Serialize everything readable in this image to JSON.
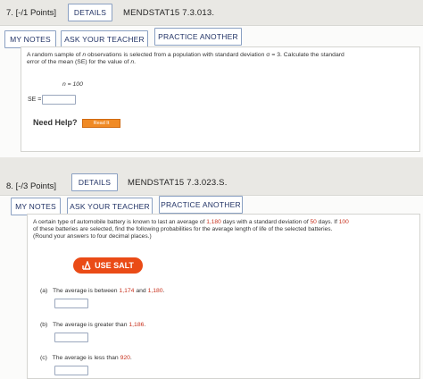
{
  "q7": {
    "number": "7.",
    "points": "[-/1 Points]",
    "details": "DETAILS",
    "code": "MENDSTAT15 7.3.013.",
    "my_notes": "MY NOTES",
    "ask_teacher": "ASK YOUR TEACHER",
    "practice": "PRACTICE ANOTHER",
    "text_line1_a": "A random sample of ",
    "text_line1_n": "n",
    "text_line1_b": " observations is selected from a population with standard deviation σ = 3. Calculate the standard",
    "text_line2_a": "error of the mean (SE) for the value of ",
    "text_line2_n": "n",
    "text_line2_b": ".",
    "n_label": "n = 100",
    "se_label": "SE =",
    "need_help": "Need Help?",
    "read_it": "Read It"
  },
  "q8": {
    "number": "8.",
    "points": "[-/3 Points]",
    "details": "DETAILS",
    "code": "MENDSTAT15 7.3.023.S.",
    "my_notes": "MY NOTES",
    "ask_teacher": "ASK YOUR TEACHER",
    "practice": "PRACTICE ANOTHER",
    "line1_a": "A certain type of automobile battery is known to last an average of ",
    "line1_v1": "1,180",
    "line1_b": " days with a standard deviation of ",
    "line1_v2": "50",
    "line1_c": " days. If ",
    "line1_v3": "100",
    "line2": "of these batteries are selected, find the following probabilities for the average length of life of the selected batteries.",
    "line3": "(Round your answers to four decimal places.)",
    "use_salt": "USE SALT",
    "a_label": "(a)",
    "a_text": "The average is between ",
    "a_v1": "1,174",
    "a_and": " and ",
    "a_v2": "1,180",
    "a_end": ".",
    "b_label": "(b)",
    "b_text": "The average is greater than ",
    "b_v": "1,186",
    "b_end": ".",
    "c_label": "(c)",
    "c_text": "The average is less than ",
    "c_v": "920",
    "c_end": "."
  }
}
